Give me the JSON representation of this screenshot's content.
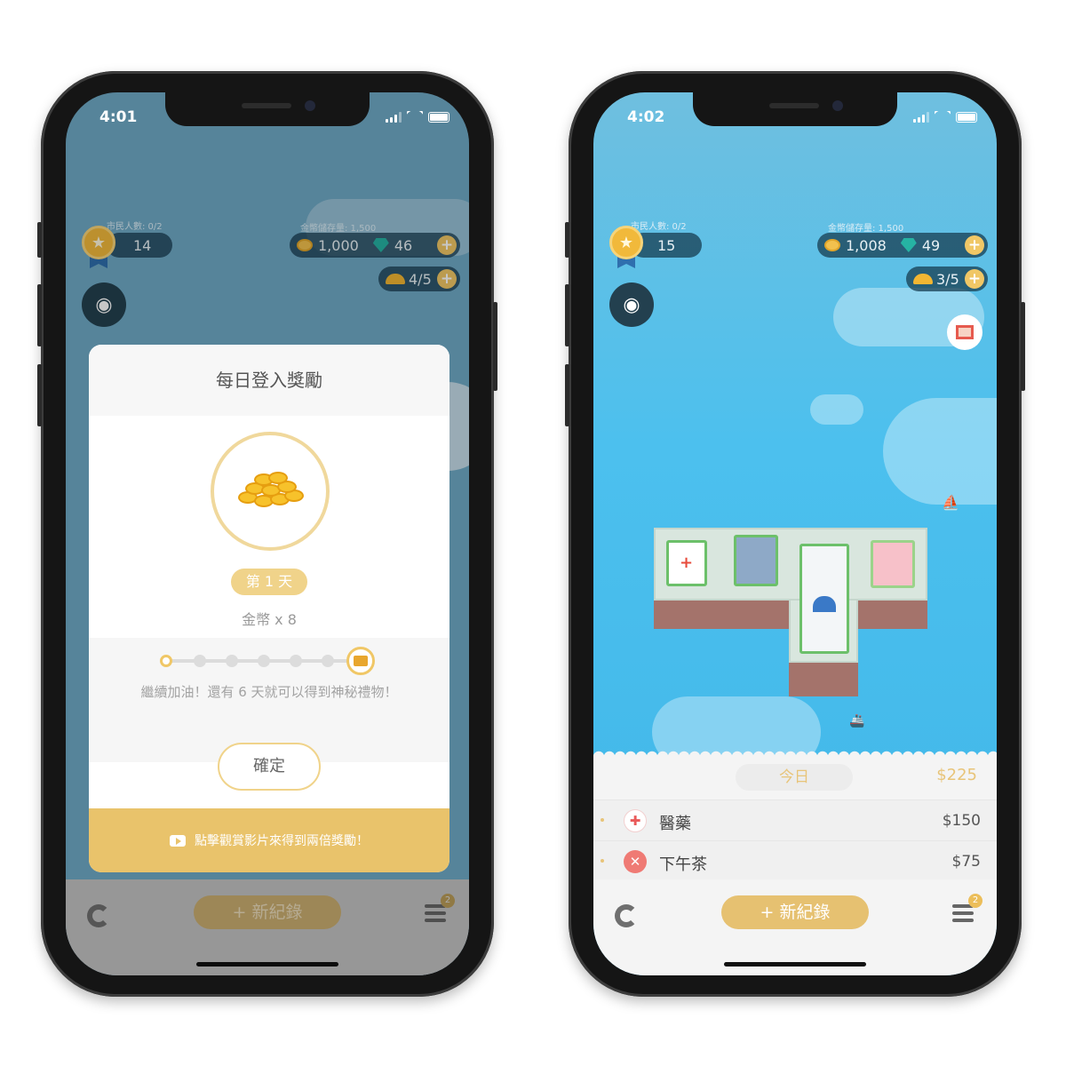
{
  "left_phone": {
    "status_time": "4:01",
    "hud": {
      "citizens_label": "市民人數: 0/2",
      "level": "14",
      "storage_label": "金幣儲存量: 1,500",
      "coins": "1,000",
      "gems": "46",
      "builders": "4/5"
    },
    "modal": {
      "title": "每日登入獎勵",
      "day": "第 1 天",
      "reward": "金幣 x 8",
      "progress_steps": 7,
      "progress_current": 1,
      "progress_text": "繼續加油！還有 6 天就可以得到神秘禮物！",
      "confirm_label": "確定",
      "video_label": "點擊觀賞影片來得到兩倍獎勵！"
    },
    "help_label": "?",
    "bottom": {
      "new_record_label": "+ 新紀錄",
      "menu_badge": "2"
    }
  },
  "right_phone": {
    "status_time": "4:02",
    "hud": {
      "citizens_label": "市民人數: 0/2",
      "level": "15",
      "storage_label": "金幣儲存量: 1,500",
      "coins": "1,008",
      "gems": "49",
      "builders": "3/5"
    },
    "ledger": {
      "today_label": "今日",
      "today_total": "$225",
      "entries": [
        {
          "name": "醫藥",
          "amount": "$150",
          "icon": "medical-cross-icon",
          "color": "#e95a5a"
        },
        {
          "name": "下午茶",
          "amount": "$75",
          "icon": "utensils-icon",
          "color": "#ef7a74"
        }
      ]
    },
    "bottom": {
      "new_record_label": "+ 新紀錄",
      "menu_badge": "2"
    }
  },
  "colors": {
    "sea": "#6fa9c6",
    "sea_bright": "#4cc0ee",
    "gold": "#e6c171",
    "modal_accent": "#f0d38a"
  }
}
